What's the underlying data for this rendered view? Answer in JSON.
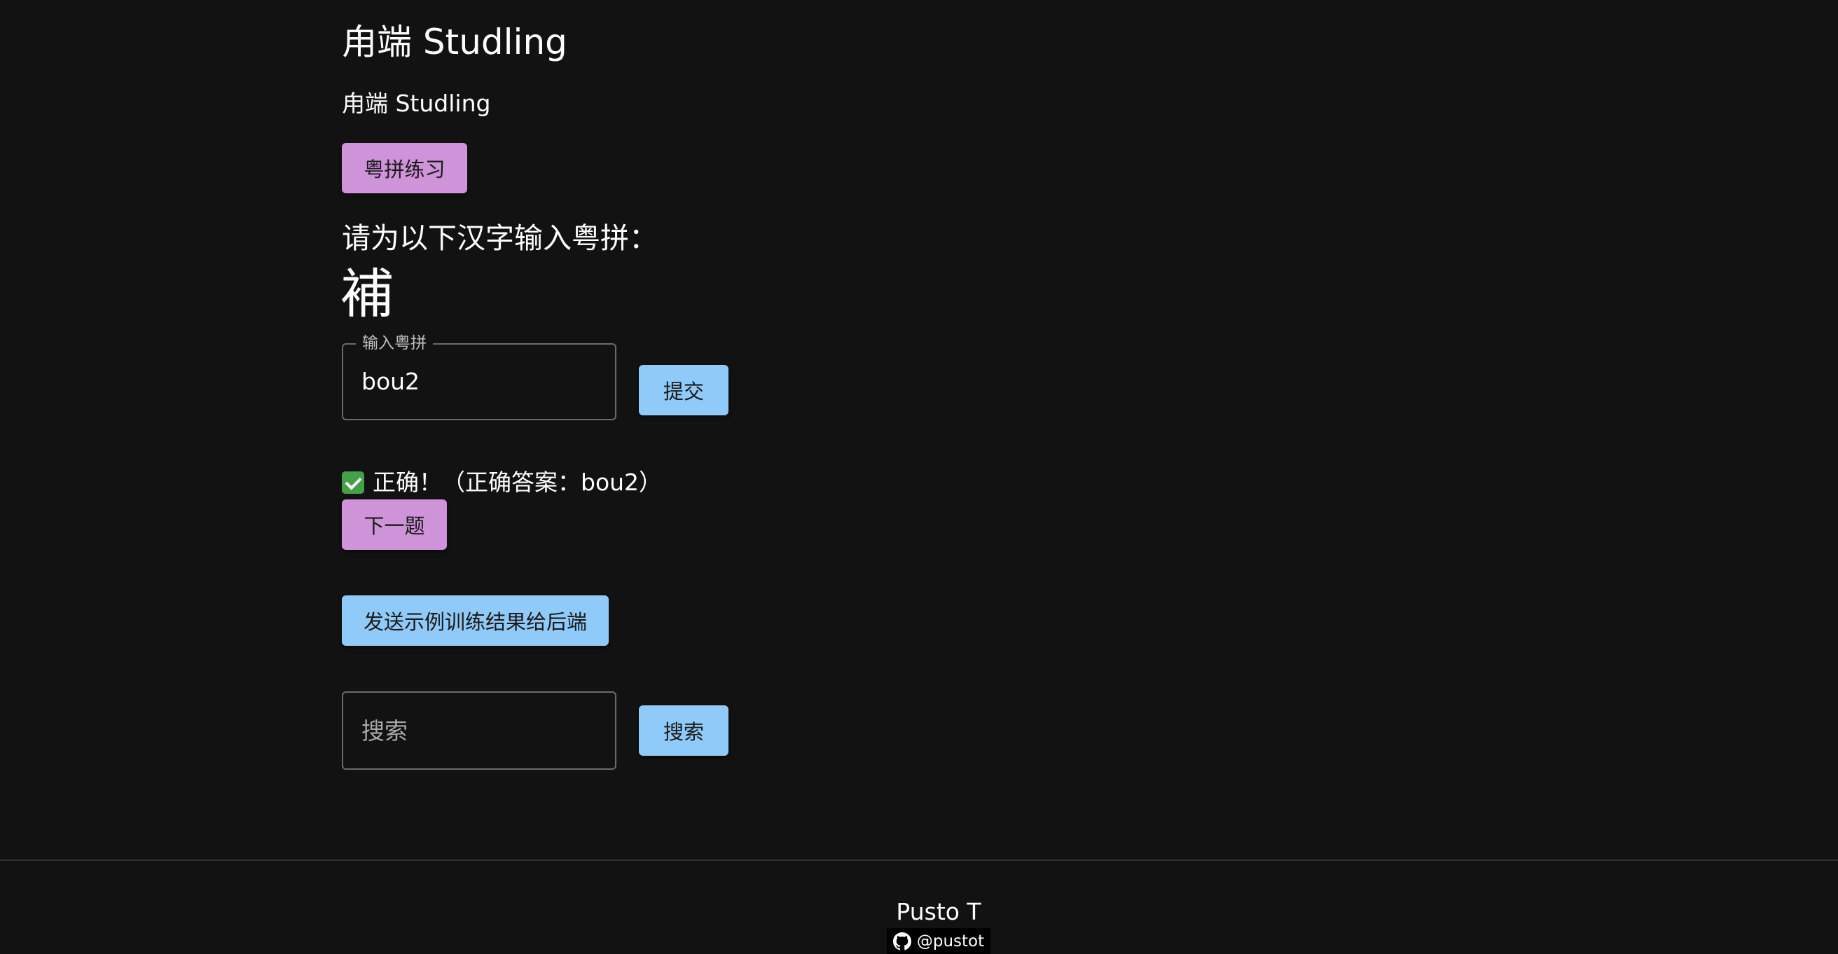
{
  "header": {
    "title": "甪端 Studling",
    "subtitle": "甪端 Studling"
  },
  "practice_button": "粤拼练习",
  "quiz": {
    "prompt": "请为以下汉字输入粤拼：",
    "character": "補",
    "input_label": "输入粤拼",
    "input_value": "bou2",
    "submit_label": "提交",
    "result_text": "正确！（正确答案：bou2）",
    "next_label": "下一题"
  },
  "send_button": "发送示例训练结果给后端",
  "search": {
    "placeholder": "搜索",
    "button_label": "搜索"
  },
  "footer": {
    "author": "Pusto T",
    "github_handle": "@pustot"
  },
  "colors": {
    "background": "#121212",
    "primary_button": "#90caf9",
    "secondary_button": "#ce93d8",
    "check": "#43a047"
  }
}
